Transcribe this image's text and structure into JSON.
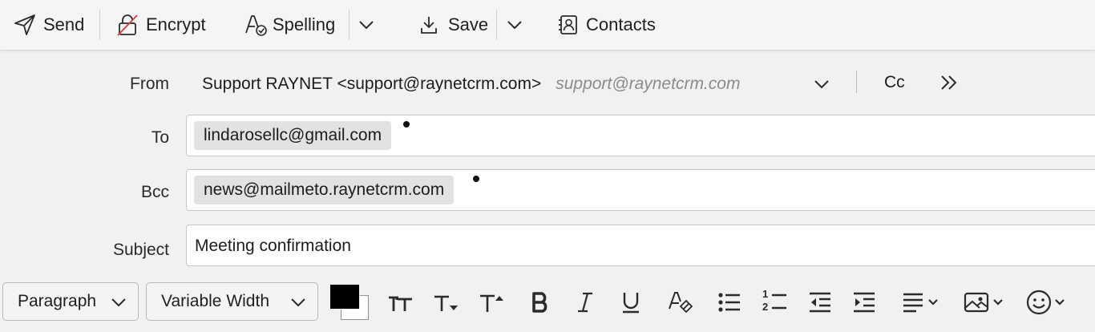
{
  "toolbar": {
    "send_label": "Send",
    "encrypt_label": "Encrypt",
    "spelling_label": "Spelling",
    "save_label": "Save",
    "contacts_label": "Contacts"
  },
  "header": {
    "from_label": "From",
    "from_identity": "Support RAYNET <support@raynetcrm.com>",
    "from_address_hint": "support@raynetcrm.com",
    "cc_label": "Cc",
    "to_label": "To",
    "to_recipients": [
      "lindarosellc@gmail.com"
    ],
    "bcc_label": "Bcc",
    "bcc_recipients": [
      "news@mailmeto.raynetcrm.com"
    ],
    "subject_label": "Subject",
    "subject_value": "Meeting confirmation"
  },
  "format_bar": {
    "paragraph_format": "Paragraph",
    "font_family": "Variable Width",
    "text_color": "#000000",
    "background_color": "#ffffff",
    "ordered_list_digits": [
      "1",
      "2"
    ]
  },
  "icons": [
    "send-icon",
    "encrypt-icon",
    "spelling-icon",
    "save-icon",
    "contacts-icon",
    "chevron-down-icon",
    "more-icon",
    "font-size-icon",
    "smaller-text-icon",
    "larger-text-icon",
    "bold-icon",
    "italic-icon",
    "underline-icon",
    "clear-format-icon",
    "bullet-list-icon",
    "numbered-list-icon",
    "outdent-icon",
    "indent-icon",
    "align-icon",
    "insert-image-icon",
    "emoji-icon"
  ]
}
